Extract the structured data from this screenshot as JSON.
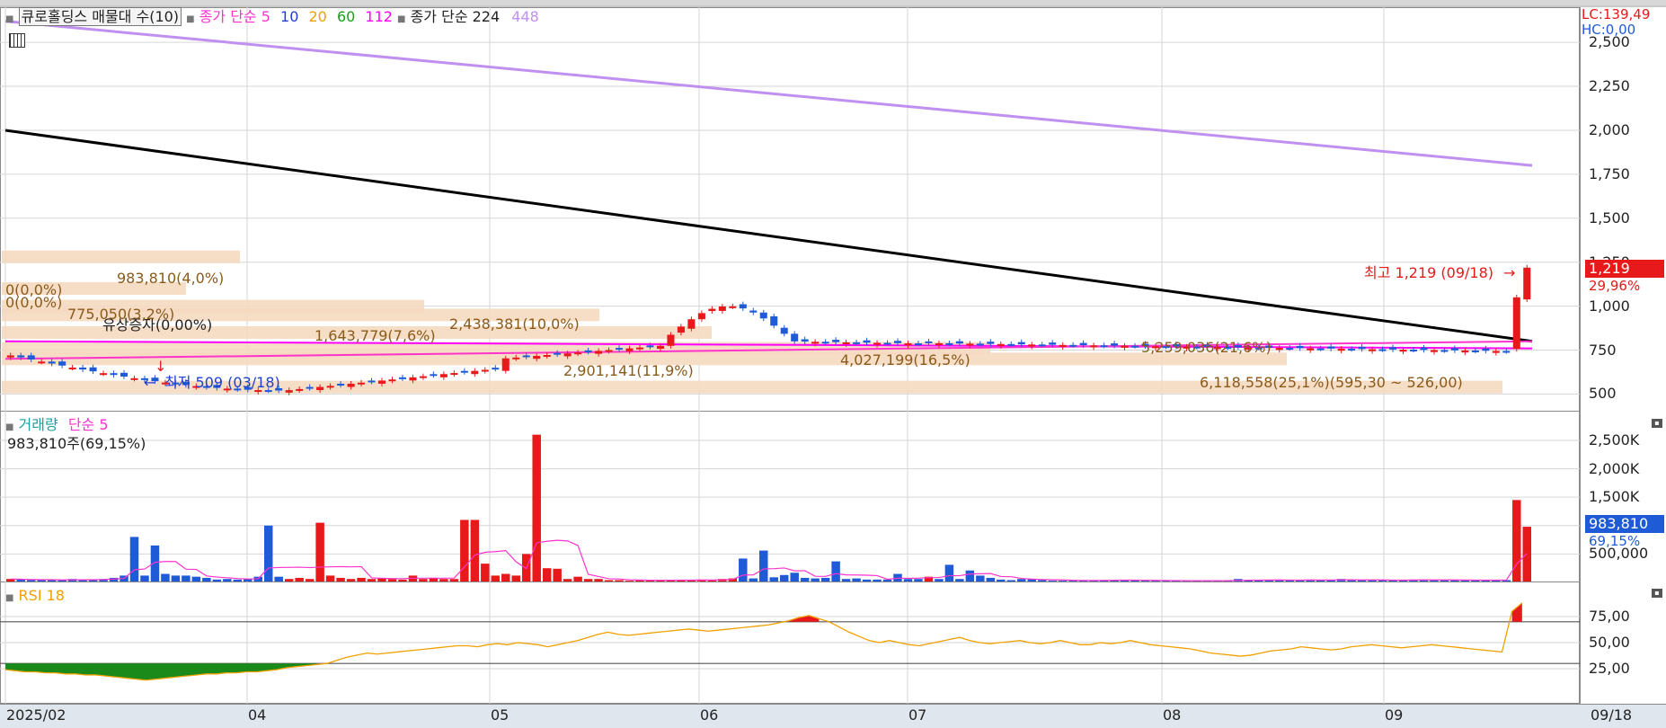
{
  "title_bar": {
    "stock_label": "큐로홀딩스 매물대 수(10)",
    "ma_label": "종가 단순",
    "ma_periods": [
      "5",
      "10",
      "20",
      "60",
      "112"
    ],
    "ma_long_label": "종가 단순 224",
    "ma_long_2": "448"
  },
  "price_pane": {
    "lc": "LC:139,49",
    "hc": "HC:0,00",
    "current_price": "1,219",
    "current_change": "29,96%",
    "high_label": "최고 1,219 (09/18)",
    "low_label": "최저 509 (03/18)",
    "event_label": "유상증자(0,00%)",
    "y_ticks": [
      "2,500",
      "2,250",
      "2,000",
      "1,750",
      "1,500",
      "1,250",
      "1,000",
      "750",
      "500"
    ],
    "volume_profile": [
      "983,810(4,0%)",
      "0(0,0%)",
      "0(0,0%)",
      "775,050(3,2%)",
      "1,643,779(7,6%)",
      "2,438,381(10,0%)",
      "2,901,141(11,9%)",
      "4,027,199(16,5%)",
      "5,259,036(21,6%)",
      "6,118,558(25,1%)(595,30 ~ 526,00)"
    ]
  },
  "volume_pane": {
    "title": "거래량",
    "ma_label": "단순 5",
    "info": "983,810주(69,15%)",
    "y_ticks": [
      "2,500K",
      "2,000K",
      "1,500K",
      "1,000K",
      "500,000"
    ],
    "current_value": "983,810",
    "current_pct": "69,15%"
  },
  "rsi_pane": {
    "title": "RSI 18",
    "y_ticks": [
      "75,00",
      "50,00",
      "25,00"
    ]
  },
  "x_axis": {
    "labels": [
      "2025/02",
      "04",
      "05",
      "06",
      "07",
      "08",
      "09"
    ],
    "current_date": "09/18"
  },
  "colors": {
    "up": "#e8191a",
    "down": "#1f5bd6",
    "ma5": "#ff33cc",
    "ma10": "#1f3fd0",
    "ma20": "#f0a000",
    "ma60": "#18a018",
    "ma112": "#ff00ff",
    "ma224": "#000000",
    "ma448": "#c090f0",
    "rsi": "#f0a000",
    "profile": "#f5d9c0"
  },
  "chart_data": [
    {
      "type": "candlestick",
      "title": "큐로홀딩스",
      "x_range": [
        "2025/02",
        "09/18"
      ],
      "ylim": [
        400,
        2700
      ],
      "series": [
        {
          "name": "종가 단순 224",
          "start": 2000,
          "end": 800
        },
        {
          "name": "448",
          "start": 2620,
          "end": 1800
        },
        {
          "name": "112",
          "start": 800,
          "end": 760
        },
        {
          "name": "5",
          "start": 700,
          "end": 800
        }
      ],
      "highlights": {
        "high": 1219,
        "low": 509,
        "last": 1219
      }
    },
    {
      "type": "bar",
      "title": "거래량",
      "ylim": [
        0,
        2800000
      ],
      "last": 983810,
      "values": [
        60,
        50,
        40,
        40,
        50,
        40,
        60,
        40,
        50,
        60,
        80,
        120,
        800,
        120,
        650,
        150,
        120,
        120,
        100,
        80,
        50,
        60,
        50,
        60,
        100,
        1000,
        100,
        60,
        80,
        60,
        1050,
        120,
        80,
        60,
        80,
        60,
        80,
        60,
        50,
        120,
        60,
        80,
        60,
        60,
        1100,
        1100,
        330,
        120,
        150,
        120,
        500,
        2600,
        250,
        240,
        60,
        100,
        60,
        60,
        40,
        40,
        30,
        40,
        40,
        40,
        40,
        40,
        40,
        50,
        40,
        60,
        70,
        420,
        70,
        560,
        90,
        130,
        170,
        80,
        70,
        80,
        370,
        60,
        70,
        50,
        50,
        50,
        150,
        60,
        60,
        100,
        60,
        310,
        60,
        210,
        120,
        80,
        50,
        40,
        60,
        60,
        40,
        30,
        30,
        30,
        40,
        40,
        40,
        40,
        40,
        40,
        30,
        30,
        30,
        30,
        30,
        30,
        30,
        30,
        30,
        60,
        40,
        40,
        40,
        40,
        40,
        40,
        50,
        40,
        40,
        60,
        40,
        40,
        40,
        40,
        40,
        40,
        50,
        50,
        40,
        40,
        40,
        40,
        40,
        40,
        40,
        40,
        1450,
        980
      ]
    },
    {
      "type": "line",
      "title": "RSI 18",
      "ylim": [
        0,
        100
      ],
      "reference_lines": [
        70,
        30
      ],
      "values": [
        24,
        23,
        22,
        22,
        21,
        21,
        20,
        20,
        19,
        19,
        18,
        17,
        16,
        15,
        14,
        15,
        16,
        17,
        18,
        19,
        20,
        20,
        21,
        21,
        22,
        22,
        23,
        24,
        26,
        27,
        28,
        29,
        30,
        33,
        36,
        38,
        40,
        39,
        40,
        41,
        42,
        43,
        44,
        45,
        46,
        47,
        47,
        46,
        48,
        49,
        48,
        50,
        49,
        48,
        46,
        48,
        50,
        52,
        55,
        58,
        60,
        58,
        57,
        58,
        59,
        60,
        61,
        62,
        63,
        62,
        61,
        62,
        63,
        64,
        65,
        66,
        67,
        69,
        71,
        74,
        76,
        73,
        70,
        65,
        60,
        56,
        52,
        50,
        52,
        50,
        48,
        47,
        49,
        51,
        53,
        55,
        52,
        50,
        49,
        50,
        51,
        52,
        50,
        49,
        50,
        52,
        50,
        48,
        48,
        50,
        49,
        50,
        52,
        50,
        48,
        47,
        46,
        45,
        44,
        42,
        40,
        39,
        38,
        37,
        38,
        40,
        42,
        43,
        44,
        46,
        45,
        44,
        43,
        44,
        46,
        47,
        48,
        47,
        46,
        45,
        46,
        47,
        48,
        47,
        46,
        45,
        44,
        43,
        42,
        41,
        80,
        88
      ]
    }
  ]
}
